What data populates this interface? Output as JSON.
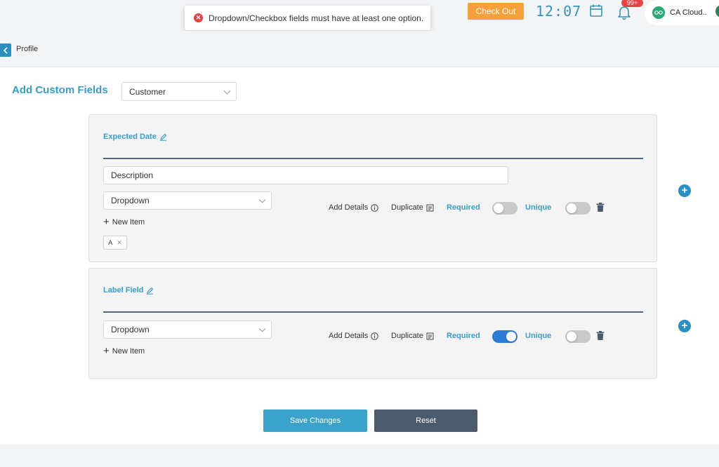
{
  "toast": {
    "message": "Dropdown/Checkbox fields must have at least one option."
  },
  "header": {
    "checkout_label": "Check Out",
    "clock": "12:07",
    "notification_badge": "99+",
    "profile_name": "CA Cloud.."
  },
  "breadcrumb": {
    "label": "Profile"
  },
  "page": {
    "title": "Add Custom Fields",
    "entity_select": "Customer"
  },
  "fields": [
    {
      "title": "Expected Date",
      "description": "Description",
      "type": "Dropdown",
      "new_item_label": "New Item",
      "options": [
        "A"
      ],
      "add_details_label": "Add Details",
      "duplicate_label": "Duplicate",
      "required_label": "Required",
      "required_on": false,
      "unique_label": "Unique",
      "unique_on": false
    },
    {
      "title": "Label Field",
      "type": "Dropdown",
      "new_item_label": "New Item",
      "add_details_label": "Add Details",
      "duplicate_label": "Duplicate",
      "required_label": "Required",
      "required_on": true,
      "unique_label": "Unique",
      "unique_on": false
    }
  ],
  "actions": {
    "save_label": "Save Changes",
    "reset_label": "Reset"
  },
  "colors": {
    "accent": "#3a9bc4",
    "checkout": "#f5a03b",
    "reset": "#4c5b6b",
    "toggle_on": "#2f7cd8"
  }
}
